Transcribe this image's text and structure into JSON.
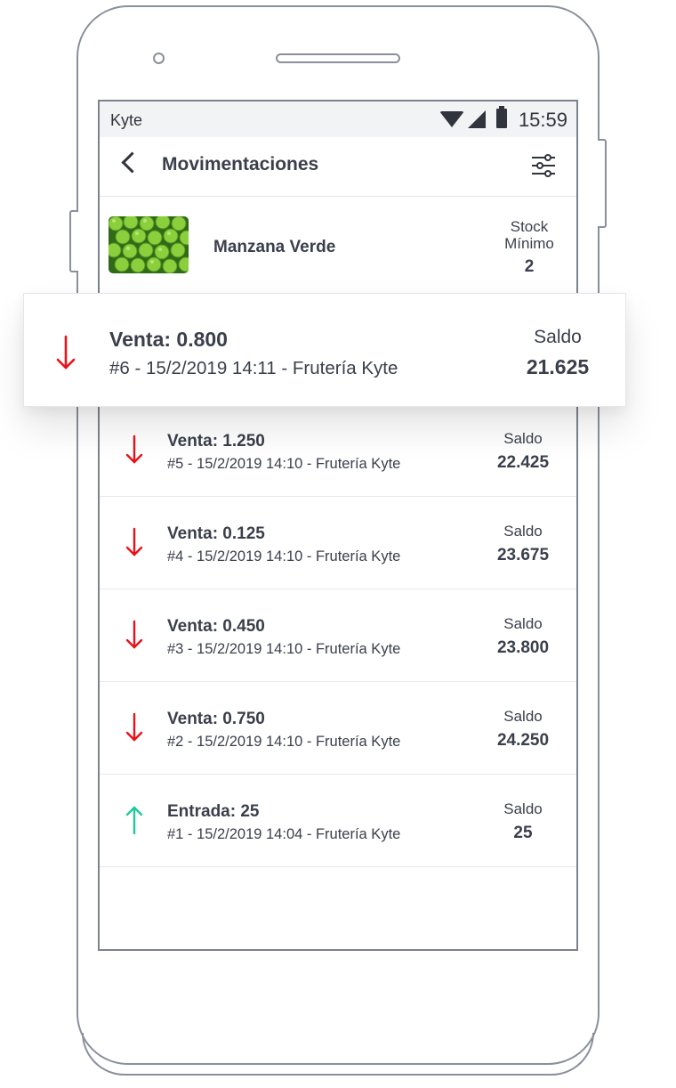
{
  "status_bar": {
    "app_name": "Kyte",
    "time": "15:59"
  },
  "header": {
    "title": "Movimentaciones"
  },
  "product": {
    "name": "Manzana Verde",
    "stock_label": "Stock Mínimo",
    "stock_value": "2"
  },
  "highlight": {
    "title": "Venta: 0.800",
    "details": "#6 - 15/2/2019 14:11 - Frutería Kyte",
    "saldo_label": "Saldo",
    "saldo_value": "21.625",
    "direction": "down"
  },
  "movements": [
    {
      "title": "Venta: 1.250",
      "details": "#5 - 15/2/2019 14:10 - Frutería Kyte",
      "saldo_label": "Saldo",
      "saldo_value": "22.425",
      "direction": "down"
    },
    {
      "title": "Venta: 0.125",
      "details": "#4 - 15/2/2019 14:10 - Frutería Kyte",
      "saldo_label": "Saldo",
      "saldo_value": "23.675",
      "direction": "down"
    },
    {
      "title": "Venta: 0.450",
      "details": "#3 - 15/2/2019 14:10 - Frutería Kyte",
      "saldo_label": "Saldo",
      "saldo_value": "23.800",
      "direction": "down"
    },
    {
      "title": "Venta: 0.750",
      "details": "#2 - 15/2/2019 14:10 - Frutería Kyte",
      "saldo_label": "Saldo",
      "saldo_value": "24.250",
      "direction": "down"
    },
    {
      "title": "Entrada: 25",
      "details": "#1 - 15/2/2019 14:04 - Frutería Kyte",
      "saldo_label": "Saldo",
      "saldo_value": "25",
      "direction": "up"
    }
  ],
  "colors": {
    "down_arrow": "#e8111a",
    "up_arrow": "#1ec99b"
  }
}
